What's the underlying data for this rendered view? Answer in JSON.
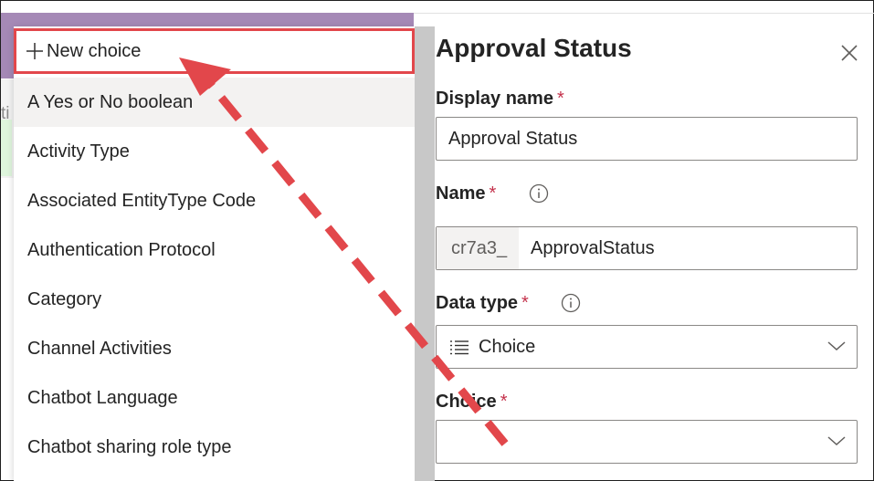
{
  "background": {
    "text_fragment": "ti"
  },
  "dropdown": {
    "new_choice_label": "New choice",
    "items": [
      {
        "label": "A Yes or No boolean"
      },
      {
        "label": "Activity Type"
      },
      {
        "label": "Associated EntityType Code"
      },
      {
        "label": "Authentication Protocol"
      },
      {
        "label": "Category"
      },
      {
        "label": "Channel Activities"
      },
      {
        "label": "Chatbot Language"
      },
      {
        "label": "Chatbot sharing role type"
      }
    ]
  },
  "panel": {
    "title": "Approval Status",
    "display_name": {
      "label": "Display name",
      "required": "*",
      "value": "Approval Status"
    },
    "name": {
      "label": "Name",
      "required": "*",
      "prefix": "cr7a3_",
      "value": "ApprovalStatus"
    },
    "data_type": {
      "label": "Data type",
      "required": "*",
      "value": "Choice"
    },
    "choice": {
      "label": "Choice",
      "required": "*",
      "value": ""
    }
  },
  "colors": {
    "highlight_box": "#e2474b",
    "arrow": "#e2474b",
    "app_header": "#a589b6",
    "required": "#c4314b"
  },
  "icons": [
    "plus-icon",
    "close-icon",
    "info-icon",
    "list-icon",
    "chevron-down-icon"
  ]
}
